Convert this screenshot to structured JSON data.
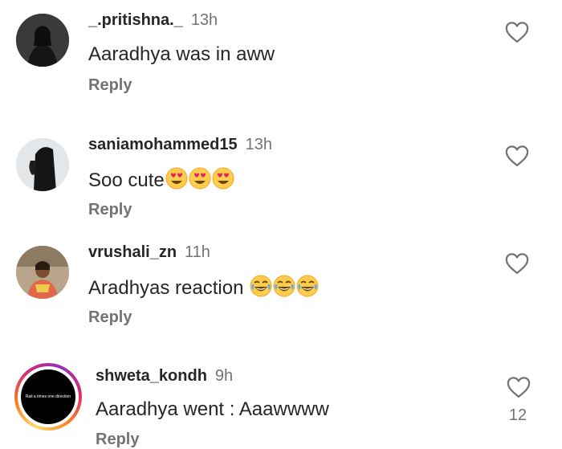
{
  "comments": [
    {
      "username": "_.pritishna._",
      "time": "13h",
      "text": "Aaradhya was in aww",
      "reply": "Reply"
    },
    {
      "username": "saniamohammed15",
      "time": "13h",
      "text": "Soo cute",
      "emojis": [
        "heart-eyes-emoji",
        "heart-eyes-emoji",
        "heart-eyes-emoji"
      ],
      "reply": "Reply"
    },
    {
      "username": "vrushali_zn",
      "time": "11h",
      "text": "Aradhyas reaction ",
      "emojis": [
        "laughing-emoji",
        "laughing-emoji",
        "laughing-emoji"
      ],
      "reply": "Reply"
    },
    {
      "username": "shweta_kondh",
      "time": "9h",
      "text": "Aaradhya went : Aaawwww",
      "reply": "Reply",
      "likes": "12",
      "avatar_caption": "Rail a times one direction"
    }
  ],
  "icons": {
    "like": "heart-outline-icon"
  },
  "colors": {
    "text": "#262626",
    "muted": "#737373",
    "story_ring": [
      "#feda75",
      "#fa7e1e",
      "#d62976",
      "#962fbf"
    ]
  }
}
